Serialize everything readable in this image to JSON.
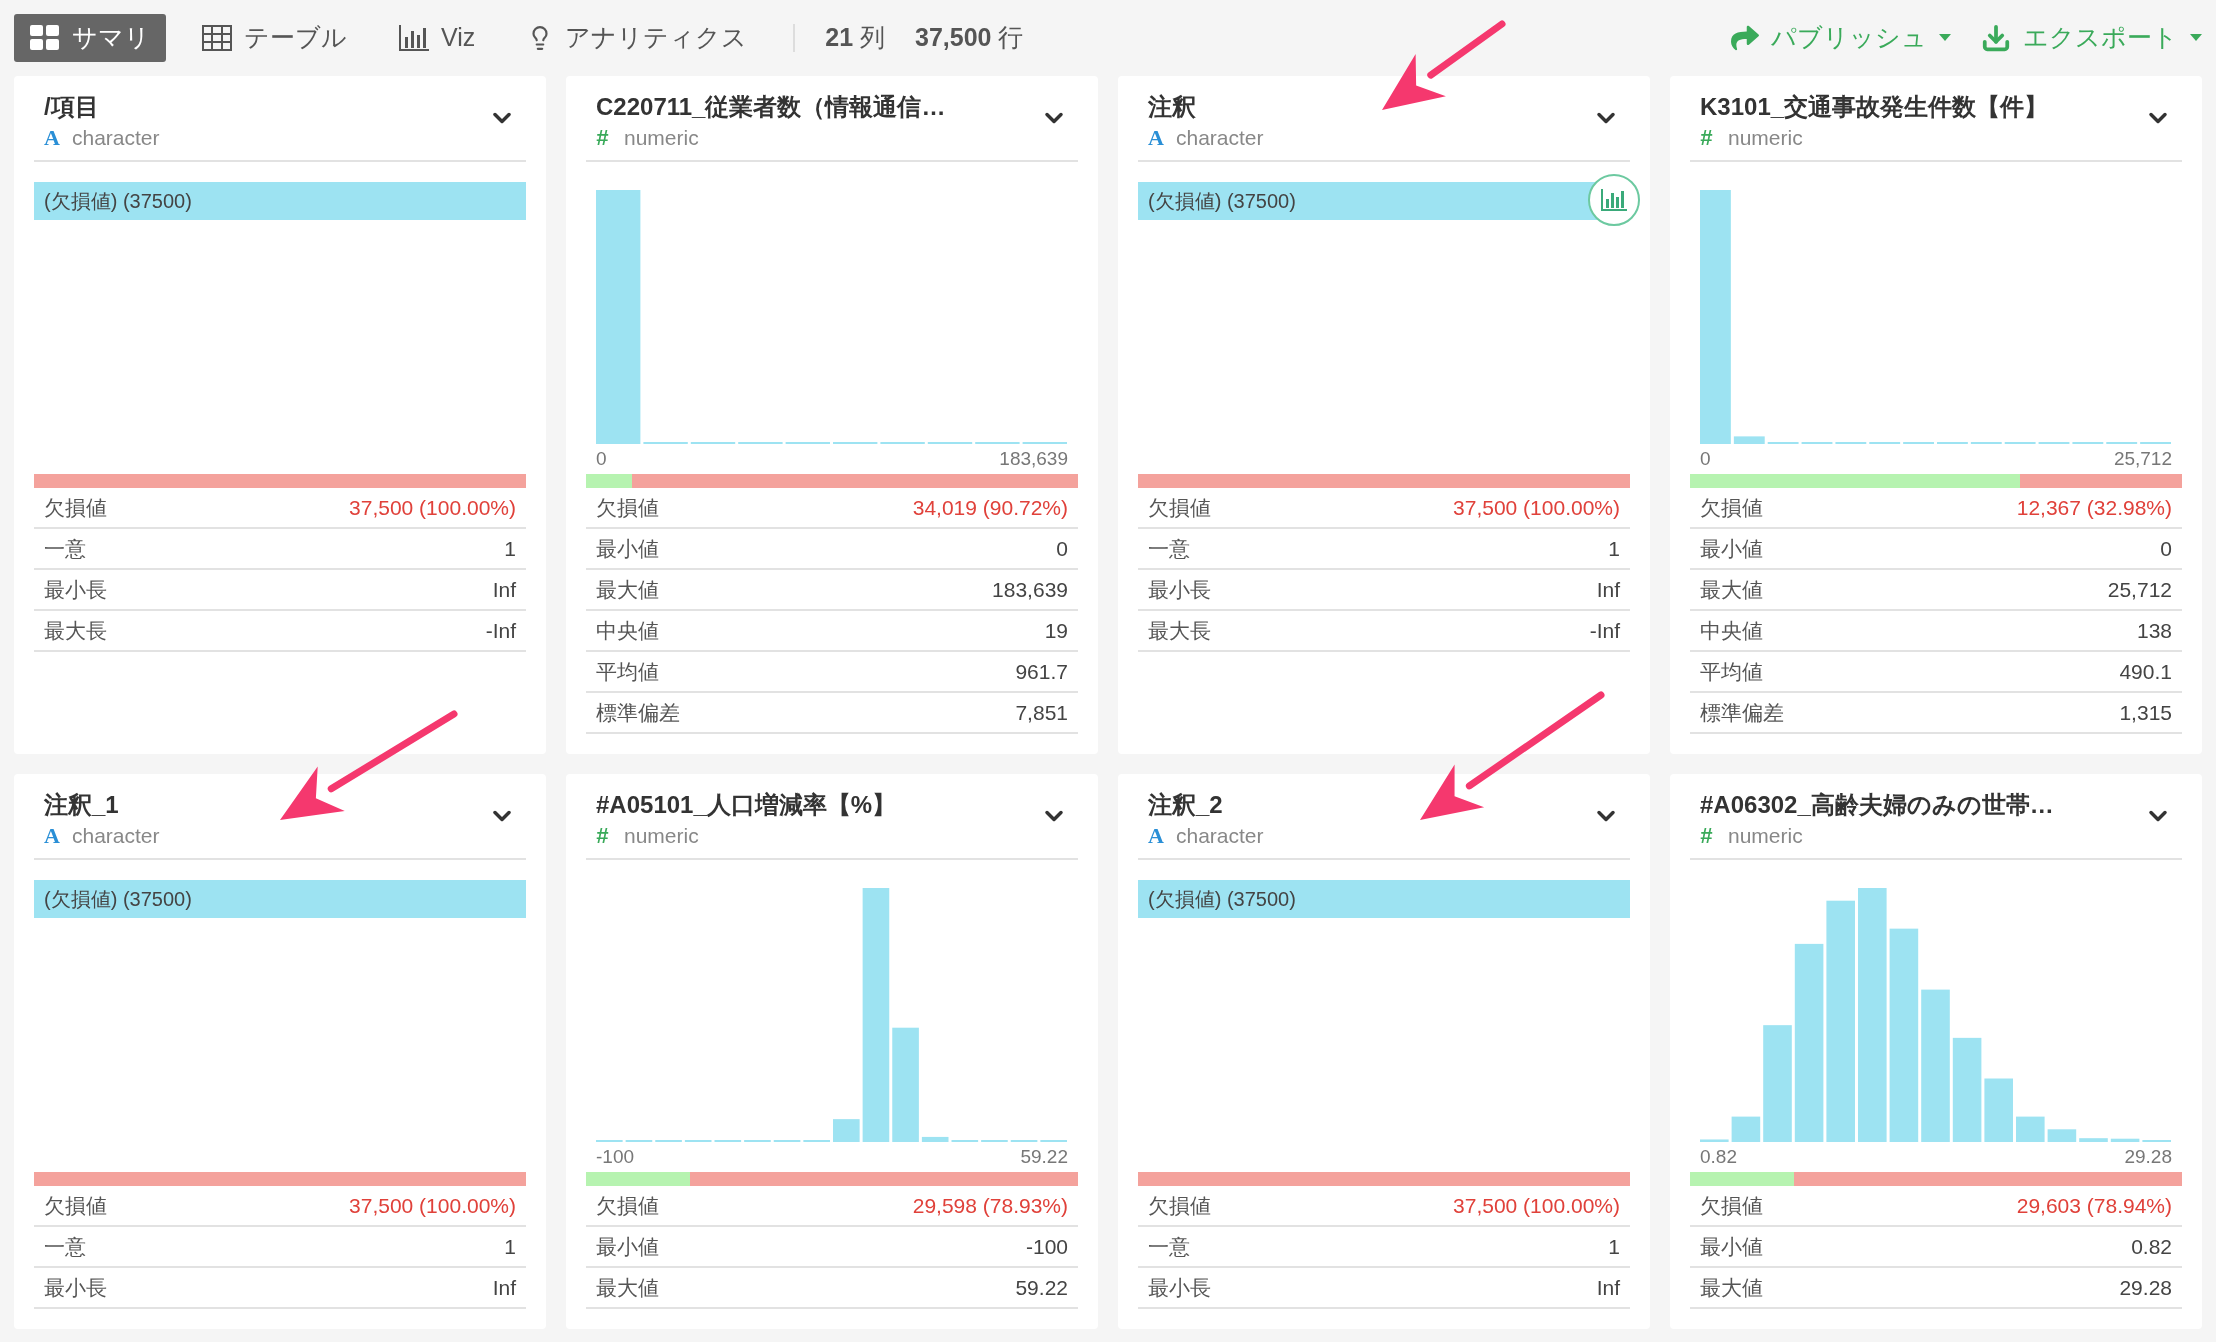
{
  "toolbar": {
    "tabs": [
      {
        "kind": "summary",
        "label": "サマリ",
        "selected": true
      },
      {
        "kind": "table",
        "label": "テーブル",
        "selected": false
      },
      {
        "kind": "viz",
        "label": "Viz",
        "selected": false
      },
      {
        "kind": "analytics",
        "label": "アナリティクス",
        "selected": false
      }
    ],
    "counts": [
      "**21** 列",
      "**37,500** 行"
    ],
    "actions": [
      {
        "kind": "publish",
        "label": "パブリッシュ"
      },
      {
        "kind": "export",
        "label": "エクスポート"
      }
    ]
  },
  "cards": [
    {
      "title": "/項目",
      "kind": "character",
      "type_icon": "A",
      "type_label": "character",
      "hovered": false,
      "top_value": "(欠損値) (37500)",
      "level": 1,
      "stats": [
        {
          "label": "欠損値",
          "value": "37,500 (100.00%)",
          "alert": true
        },
        {
          "label": "一意",
          "value": "1",
          "alert": false
        },
        {
          "label": "最小長",
          "value": "Inf",
          "alert": false
        },
        {
          "label": "最大長",
          "value": "-Inf",
          "alert": false
        }
      ]
    },
    {
      "title": "C220711_従業者数（情報通信…",
      "kind": "numeric",
      "type_icon": "#",
      "type_label": "numeric",
      "hovered": false,
      "axis_min": "0",
      "axis_max": "183,639",
      "level": 0.907,
      "stats": [
        {
          "label": "欠損値",
          "value": "34,019 (90.72%)",
          "alert": true
        },
        {
          "label": "最小値",
          "value": "0",
          "alert": false
        },
        {
          "label": "最大値",
          "value": "183,639",
          "alert": false
        },
        {
          "label": "中央値",
          "value": "19",
          "alert": false
        },
        {
          "label": "平均値",
          "value": "961.7",
          "alert": false
        },
        {
          "label": "標準偏差",
          "value": "7,851",
          "alert": false
        }
      ]
    },
    {
      "title": "注釈",
      "kind": "character",
      "type_icon": "A",
      "type_label": "character",
      "hovered": true,
      "top_value": "(欠損値) (37500)",
      "level": 1,
      "stats": [
        {
          "label": "欠損値",
          "value": "37,500 (100.00%)",
          "alert": true
        },
        {
          "label": "一意",
          "value": "1",
          "alert": false
        },
        {
          "label": "最小長",
          "value": "Inf",
          "alert": false
        },
        {
          "label": "最大長",
          "value": "-Inf",
          "alert": false
        }
      ]
    },
    {
      "title": "K3101_交通事故発生件数【件】",
      "kind": "numeric",
      "type_icon": "#",
      "type_label": "numeric",
      "hovered": false,
      "axis_min": "0",
      "axis_max": "25,712",
      "level": 0.33,
      "stats": [
        {
          "label": "欠損値",
          "value": "12,367 (32.98%)",
          "alert": true
        },
        {
          "label": "最小値",
          "value": "0",
          "alert": false
        },
        {
          "label": "最大値",
          "value": "25,712",
          "alert": false
        },
        {
          "label": "中央値",
          "value": "138",
          "alert": false
        },
        {
          "label": "平均値",
          "value": "490.1",
          "alert": false
        },
        {
          "label": "標準偏差",
          "value": "1,315",
          "alert": false
        }
      ]
    },
    {
      "title": "注釈_1",
      "kind": "character",
      "type_icon": "A",
      "type_label": "character",
      "hovered": false,
      "top_value": "(欠損値) (37500)",
      "level": 1,
      "stats": [
        {
          "label": "欠損値",
          "value": "37,500 (100.00%)",
          "alert": true
        },
        {
          "label": "一意",
          "value": "1",
          "alert": false
        },
        {
          "label": "最小長",
          "value": "Inf",
          "alert": false
        }
      ]
    },
    {
      "title": "#A05101_人口増減率【%】",
      "kind": "numeric",
      "type_icon": "#",
      "type_label": "numeric",
      "hovered": false,
      "axis_min": "-100",
      "axis_max": "59.22",
      "level": 0.789,
      "stats": [
        {
          "label": "欠損値",
          "value": "29,598 (78.93%)",
          "alert": true
        },
        {
          "label": "最小値",
          "value": "-100",
          "alert": false
        },
        {
          "label": "最大値",
          "value": "59.22",
          "alert": false
        }
      ]
    },
    {
      "title": "注釈_2",
      "kind": "character",
      "type_icon": "A",
      "type_label": "character",
      "hovered": false,
      "top_value": "(欠損値) (37500)",
      "level": 1,
      "stats": [
        {
          "label": "欠損値",
          "value": "37,500 (100.00%)",
          "alert": true
        },
        {
          "label": "一意",
          "value": "1",
          "alert": false
        },
        {
          "label": "最小長",
          "value": "Inf",
          "alert": false
        }
      ]
    },
    {
      "title": "#A06302_高齢夫婦のみの世帯…",
      "kind": "numeric",
      "type_icon": "#",
      "type_label": "numeric",
      "hovered": false,
      "axis_min": "0.82",
      "axis_max": "29.28",
      "level": 0.789,
      "stats": [
        {
          "label": "欠損値",
          "value": "29,603 (78.94%)",
          "alert": true
        },
        {
          "label": "最小値",
          "value": "0.82",
          "alert": false
        },
        {
          "label": "最大値",
          "value": "29.28",
          "alert": false
        }
      ]
    }
  ]
}
